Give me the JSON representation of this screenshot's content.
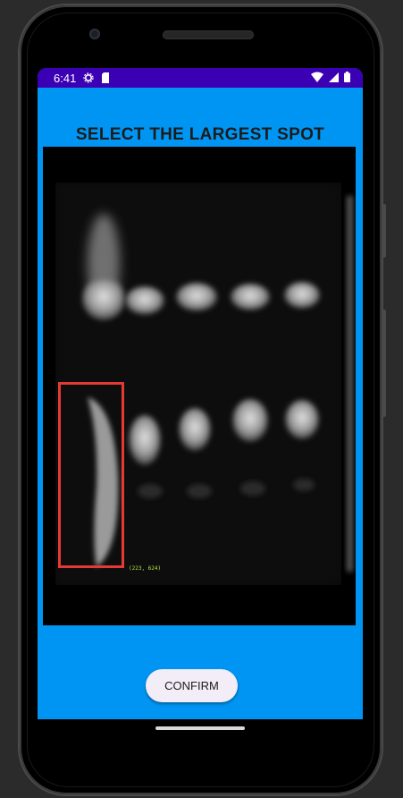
{
  "status_bar": {
    "time": "6:41",
    "icons": [
      "settings-gear-icon",
      "sd-card-icon",
      "wifi-icon",
      "signal-icon",
      "battery-icon"
    ]
  },
  "screen": {
    "title": "SELECT THE LARGEST SPOT",
    "selection_coordinates": "(223, 624)",
    "confirm_label": "CONFIRM"
  },
  "colors": {
    "status_bar": "#3c00b4",
    "background": "#0095f3",
    "selection_border": "#e53935",
    "coordinate_text": "#b6e04a",
    "button_background": "#f3edf7"
  }
}
